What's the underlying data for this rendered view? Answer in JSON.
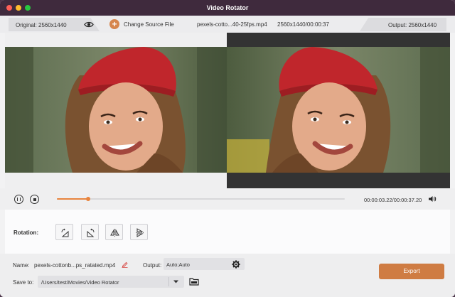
{
  "window": {
    "title": "Video Rotator"
  },
  "topbar": {
    "original_label": "Original: 2560x1440",
    "change_source_label": "Change Source File",
    "file_name": "pexels-cotto...40-25fps.mp4",
    "file_info": "2560x1440/00:00:37",
    "output_label": "Output: 2560x1440"
  },
  "playback": {
    "time": "00:00:03.22/00:00:37.20",
    "progress": 0.108
  },
  "rotation": {
    "label": "Rotation:",
    "buttons": [
      "rotate-left",
      "rotate-right",
      "flip-horizontal",
      "flip-vertical"
    ]
  },
  "output_settings": {
    "name_label": "Name:",
    "name_value": "pexels-cottonb...ps_ratated.mp4",
    "output_label": "Output:",
    "output_value": "Auto;Auto",
    "save_to_label": "Save to:",
    "save_to_path": "/Users/test/Movies/Video Rotator",
    "export_label": "Export"
  },
  "colors": {
    "accent": "#e8843e",
    "export_button": "#cf7c43",
    "titlebar": "#3f2a3d"
  },
  "icons": [
    "eye-icon",
    "plus-icon",
    "pause-icon",
    "stop-icon",
    "volume-icon",
    "edit-icon",
    "gear-icon",
    "chevron-down-icon",
    "folder-icon"
  ]
}
